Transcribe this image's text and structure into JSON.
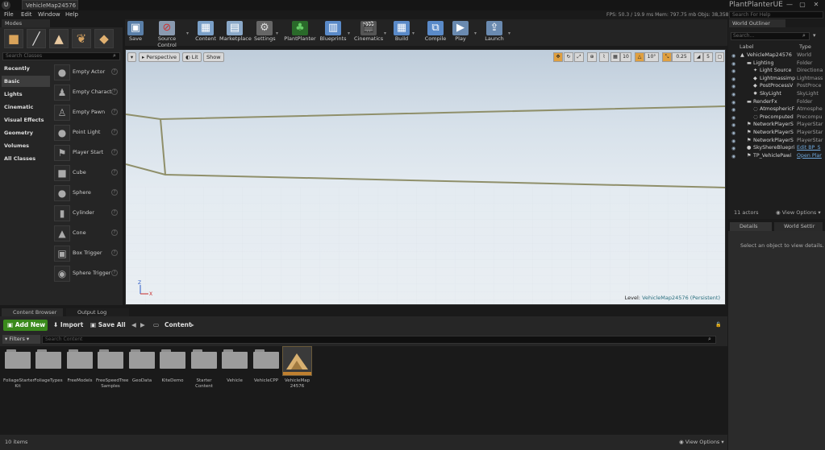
{
  "window": {
    "tab_title": "VehicleMap24576",
    "project": "PlantPlanterUE",
    "logo": "U"
  },
  "menu": [
    "File",
    "Edit",
    "Window",
    "Help"
  ],
  "stats": "FPS: 50.3 / 19.9 ms   Mem: 797.75 mb   Objs: 38,358",
  "search_help_placeholder": "Search For Help",
  "modes": {
    "tab_label": "Modes",
    "search_placeholder": "Search Classes",
    "categories": [
      "Recently Placed",
      "Basic",
      "Lights",
      "Cinematic",
      "Visual Effects",
      "Geometry",
      "Volumes",
      "All Classes"
    ],
    "selected_category": "Basic",
    "items": [
      "Empty Actor",
      "Empty Charact",
      "Empty Pawn",
      "Point Light",
      "Player Start",
      "Cube",
      "Sphere",
      "Cylinder",
      "Cone",
      "Box Trigger",
      "Sphere Trigger"
    ]
  },
  "toolbar": [
    "Save",
    "Source Control",
    "Content",
    "Marketplace",
    "Settings",
    "PlantPlanter",
    "Blueprints",
    "Cinematics",
    "Build",
    "Compile",
    "Play",
    "Launch"
  ],
  "viewport": {
    "perspective": "Perspective",
    "lit": "Lit",
    "show": "Show",
    "grid_snap": "10",
    "rot_snap": "10°",
    "scale_snap": "0.25",
    "cam_speed": "5",
    "level_label": "Level:",
    "level_name": "VehicleMap24576 (Persistent)"
  },
  "outliner": {
    "tab_label": "World Outliner",
    "search_placeholder": "Search...",
    "col_label": "Label",
    "col_type": "Type",
    "rows": [
      {
        "label": "VehicleMap24576",
        "type": "World"
      },
      {
        "label": "Lighting",
        "type": "Folder"
      },
      {
        "label": "Light Source",
        "type": "Directiona"
      },
      {
        "label": "Lightmassimp",
        "type": "Lightmass"
      },
      {
        "label": "PostProcessV",
        "type": "PostProce"
      },
      {
        "label": "SkyLight",
        "type": "SkyLight"
      },
      {
        "label": "RenderFx",
        "type": "Folder"
      },
      {
        "label": "AtmosphericF",
        "type": "Atmosphe"
      },
      {
        "label": "Precomputed",
        "type": "Precompu"
      },
      {
        "label": "NetworkPlayerS",
        "type": "PlayerStar"
      },
      {
        "label": "NetworkPlayerS",
        "type": "PlayerStar"
      },
      {
        "label": "NetworkPlayerS",
        "type": "PlayerStar"
      },
      {
        "label": "SkyShereBluepri",
        "type": "Edit BP_S"
      },
      {
        "label": "TP_VehiclePawi",
        "type": "Open Plar"
      }
    ],
    "actor_count": "11 actors",
    "view_options": "View Options"
  },
  "details": {
    "tab1": "Details",
    "tab2": "World Settir",
    "message": "Select an object to view details."
  },
  "content_browser": {
    "tab1": "Content Browser",
    "tab2": "Output Log",
    "add_new": "Add New",
    "import": "Import",
    "save_all": "Save All",
    "path": "Content",
    "filters": "Filters",
    "search_placeholder": "Search Content",
    "assets": [
      "FoliageStarter Kit",
      "FoliageTypes",
      "FreeModels",
      "FreeSpeedTree Samples",
      "GeoData",
      "KiteDemo",
      "Starter Content",
      "Vehicle",
      "VehicleCPP",
      "VehicleMap 24576"
    ],
    "item_count": "10 items",
    "view_options": "View Options"
  }
}
